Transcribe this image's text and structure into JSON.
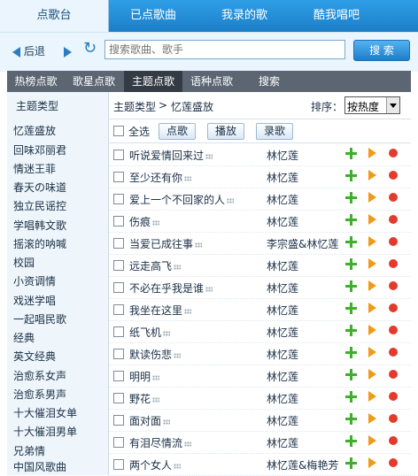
{
  "top_tabs": [
    "点歌台",
    "已点歌曲",
    "我录的歌",
    "酷我唱吧"
  ],
  "toolbar": {
    "back_label": "后退",
    "search_placeholder": "搜索歌曲、歌手",
    "search_button": "搜 索"
  },
  "category_tabs": [
    "热榜点歌",
    "歌星点歌",
    "主题点歌",
    "语种点歌",
    "搜索"
  ],
  "sidebar": {
    "header": "主题类型",
    "items": [
      "忆莲盛放",
      "回味邓丽君",
      "情迷王菲",
      "春天の味道",
      "独立民谣控",
      "学唱韩文歌",
      "摇滚的呐喊",
      "校园",
      "小资调情",
      "戏迷学唱",
      "一起唱民歌",
      "经典",
      "英文经典",
      "治愈系女声",
      "治愈系男声",
      "十大催泪女单",
      "十大催泪男单",
      "兄弟情",
      "中国风歌曲"
    ]
  },
  "breadcrumb": {
    "root": "主题类型",
    "sep": ">",
    "current": "忆莲盛放"
  },
  "sort": {
    "label": "排序：",
    "value": "按热度"
  },
  "actions": {
    "select_all": "全选",
    "sing": "点歌",
    "play": "播放",
    "record": "录歌"
  },
  "songs": [
    {
      "title": "听说爱情回来过",
      "artist": "林忆莲"
    },
    {
      "title": "至少还有你",
      "artist": "林忆莲"
    },
    {
      "title": "爱上一个不回家的人",
      "artist": "林忆莲"
    },
    {
      "title": "伤痕",
      "artist": "林忆莲"
    },
    {
      "title": "当爱已成往事",
      "artist": "李宗盛&林忆莲"
    },
    {
      "title": "远走高飞",
      "artist": "林忆莲"
    },
    {
      "title": "不必在乎我是谁",
      "artist": "林忆莲"
    },
    {
      "title": "我坐在这里",
      "artist": "林忆莲"
    },
    {
      "title": "纸飞机",
      "artist": "林忆莲"
    },
    {
      "title": "默读伤悲",
      "artist": "林忆莲"
    },
    {
      "title": "明明",
      "artist": "林忆莲"
    },
    {
      "title": "野花",
      "artist": "林忆莲"
    },
    {
      "title": "面对面",
      "artist": "林忆莲"
    },
    {
      "title": "有泪尽情流",
      "artist": "林忆莲"
    },
    {
      "title": "两个女人",
      "artist": "林忆莲&梅艳芳"
    }
  ],
  "colors": {
    "accent": "#1c7fc8",
    "add": "#3eae2c",
    "play": "#f09a1a",
    "record": "#e23a2c"
  }
}
